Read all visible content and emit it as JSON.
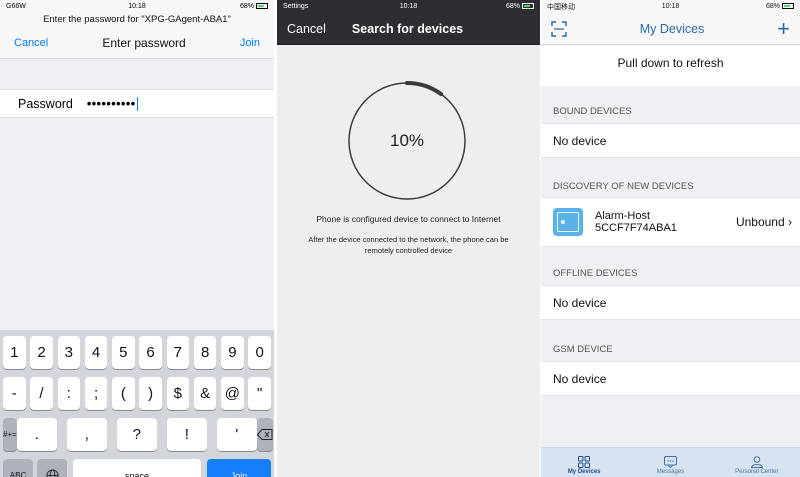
{
  "panel1": {
    "status": {
      "carrier": "G66W",
      "time": "10:18",
      "battery": "68%"
    },
    "prompt": "Enter the password for \"XPG-GAgent-ABA1\"",
    "nav": {
      "cancel": "Cancel",
      "title": "Enter password",
      "join": "Join"
    },
    "field": {
      "label": "Password",
      "value": "••••••••••"
    },
    "keyboard": {
      "row1": [
        "1",
        "2",
        "3",
        "4",
        "5",
        "6",
        "7",
        "8",
        "9",
        "0"
      ],
      "row2": [
        "-",
        "/",
        ":",
        ";",
        "(",
        ")",
        "$",
        "&",
        "@",
        "\""
      ],
      "row3_left": "#+=",
      "row3": [
        ".",
        ",",
        "?",
        "!",
        "'"
      ],
      "row4": {
        "abc": "ABC",
        "space": "space",
        "join": "Join"
      }
    }
  },
  "panel2": {
    "status": {
      "carrier": "Settings",
      "time": "10:18",
      "battery": "68%"
    },
    "nav": {
      "cancel": "Cancel",
      "title": "Search for devices"
    },
    "progress_text": "10%",
    "progress_value": 0.1,
    "message1": "Phone is configured device to connect to Internet",
    "message2": "After the device connected to the network, the phone can be remotely controlled device"
  },
  "panel3": {
    "status": {
      "carrier": "中国移动",
      "time": "10:18",
      "battery": "68%"
    },
    "nav": {
      "title": "My Devices"
    },
    "pull": "Pull down to refresh",
    "sections": {
      "bound": "BOUND DEVICES",
      "discovery": "DISCOVERY OF NEW DEVICES",
      "offline": "OFFLINE DEVICES",
      "gsm": "GSM DEVICE"
    },
    "no_device": "No device",
    "device": {
      "name": "Alarm-Host",
      "id": "5CCF7F74ABA1",
      "status": "Unbound"
    },
    "tabs": {
      "devices": "My Devices",
      "messages": "Messages",
      "personal": "Personal Center"
    }
  }
}
